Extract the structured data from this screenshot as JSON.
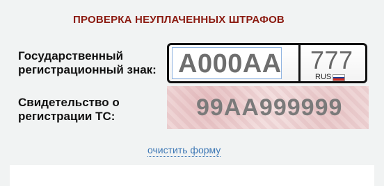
{
  "form": {
    "heading": "ПРОВЕРКА НЕУПЛАЧЕННЫХ ШТРАФОВ",
    "plate_label": "Государственный\nрегистрационный знак:",
    "plate_number": "А000АА",
    "plate_region": "777",
    "plate_country": "RUS",
    "sts_label": "Свидетельство о\nрегистрации ТС:",
    "sts_value": "99АА999999",
    "clear_link": "очистить форму"
  },
  "colors": {
    "heading": "#8b1a10",
    "link": "#3e78b5",
    "flag": [
      "#ffffff",
      "#1c3f94",
      "#d52b1e"
    ]
  },
  "icons": {
    "flag": "russian-flag-icon"
  }
}
